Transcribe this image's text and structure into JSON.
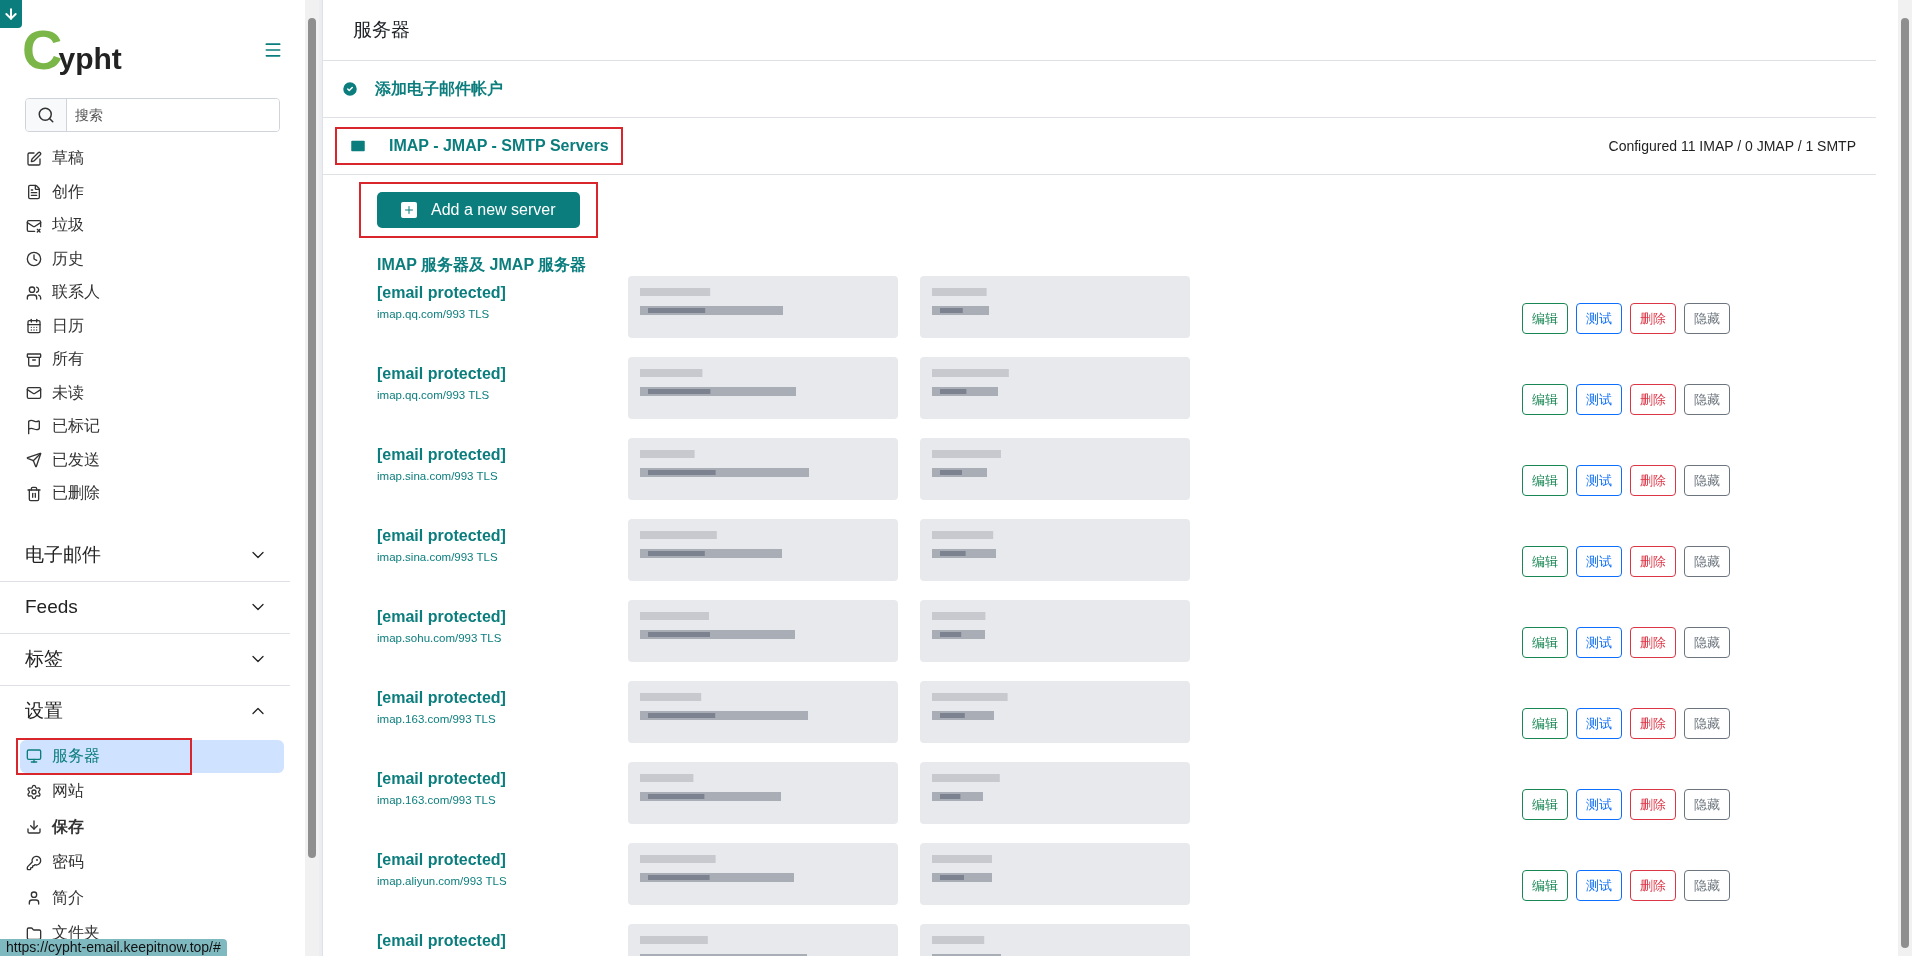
{
  "logo": {
    "first": "C",
    "rest": "ypht"
  },
  "search": {
    "placeholder": "搜索"
  },
  "nav": [
    {
      "label": "草稿"
    },
    {
      "label": "创作"
    },
    {
      "label": "垃圾"
    },
    {
      "label": "历史"
    },
    {
      "label": "联系人"
    },
    {
      "label": "日历"
    },
    {
      "label": "所有"
    },
    {
      "label": "未读"
    },
    {
      "label": "已标记"
    },
    {
      "label": "已发送"
    },
    {
      "label": "已删除"
    }
  ],
  "sections": [
    {
      "label": "电子邮件",
      "expanded": false
    },
    {
      "label": "Feeds",
      "expanded": false
    },
    {
      "label": "标签",
      "expanded": false
    },
    {
      "label": "设置",
      "expanded": true,
      "items": [
        {
          "label": "服务器",
          "selected": true,
          "highlighted": true
        },
        {
          "label": "网站",
          "selected": false,
          "highlighted": false
        },
        {
          "label": "保存",
          "selected": false,
          "highlighted": false,
          "bold": true
        },
        {
          "label": "密码",
          "selected": false,
          "highlighted": false
        },
        {
          "label": "简介",
          "selected": false,
          "highlighted": false
        },
        {
          "label": "文件夹",
          "selected": false,
          "highlighted": false
        }
      ]
    }
  ],
  "status_url": "https://cypht-email.keepitnow.top/#",
  "page_title": "服务器",
  "add_account": {
    "label": "添加电子邮件帐户"
  },
  "servers_panel": {
    "label": "IMAP - JMAP - SMTP Servers",
    "highlighted": true,
    "summary": "Configured 11 IMAP / 0 JMAP / 1 SMTP"
  },
  "add_button": {
    "label": "Add a new server",
    "highlighted": true
  },
  "imap_heading": "IMAP 服务器及 JMAP 服务器",
  "servers": [
    {
      "name": "[email protected]",
      "host": "imap.qq.com/993 TLS",
      "actions": [
        {
          "kind": "edit",
          "label": "编辑"
        },
        {
          "kind": "test",
          "label": "测试"
        },
        {
          "kind": "delete",
          "label": "删除"
        },
        {
          "kind": "hide",
          "label": "隐藏"
        }
      ]
    },
    {
      "name": "[email protected]",
      "host": "imap.qq.com/993 TLS",
      "actions": [
        {
          "kind": "edit",
          "label": "编辑"
        },
        {
          "kind": "test",
          "label": "测试"
        },
        {
          "kind": "delete",
          "label": "删除"
        },
        {
          "kind": "hide",
          "label": "隐藏"
        }
      ]
    },
    {
      "name": "[email protected]",
      "host": "imap.sina.com/993 TLS",
      "actions": [
        {
          "kind": "edit",
          "label": "编辑"
        },
        {
          "kind": "test",
          "label": "测试"
        },
        {
          "kind": "delete",
          "label": "删除"
        },
        {
          "kind": "hide",
          "label": "隐藏"
        }
      ]
    },
    {
      "name": "[email protected]",
      "host": "imap.sina.com/993 TLS",
      "actions": [
        {
          "kind": "edit",
          "label": "编辑"
        },
        {
          "kind": "test",
          "label": "测试"
        },
        {
          "kind": "delete",
          "label": "删除"
        },
        {
          "kind": "hide",
          "label": "隐藏"
        }
      ]
    },
    {
      "name": "[email protected]",
      "host": "imap.sohu.com/993 TLS",
      "actions": [
        {
          "kind": "edit",
          "label": "编辑"
        },
        {
          "kind": "test",
          "label": "测试"
        },
        {
          "kind": "delete",
          "label": "删除"
        },
        {
          "kind": "hide",
          "label": "隐藏"
        }
      ]
    },
    {
      "name": "[email protected]",
      "host": "imap.163.com/993 TLS",
      "actions": [
        {
          "kind": "edit",
          "label": "编辑"
        },
        {
          "kind": "test",
          "label": "测试"
        },
        {
          "kind": "delete",
          "label": "删除"
        },
        {
          "kind": "hide",
          "label": "隐藏"
        }
      ]
    },
    {
      "name": "[email protected]",
      "host": "imap.163.com/993 TLS",
      "actions": [
        {
          "kind": "edit",
          "label": "编辑"
        },
        {
          "kind": "test",
          "label": "测试"
        },
        {
          "kind": "delete",
          "label": "删除"
        },
        {
          "kind": "hide",
          "label": "隐藏"
        }
      ]
    },
    {
      "name": "[email protected]",
      "host": "imap.aliyun.com/993 TLS",
      "actions": [
        {
          "kind": "edit",
          "label": "编辑"
        },
        {
          "kind": "test",
          "label": "测试"
        },
        {
          "kind": "delete",
          "label": "删除"
        },
        {
          "kind": "hide",
          "label": "隐藏"
        }
      ]
    },
    {
      "name": "[email protected]"
    }
  ]
}
